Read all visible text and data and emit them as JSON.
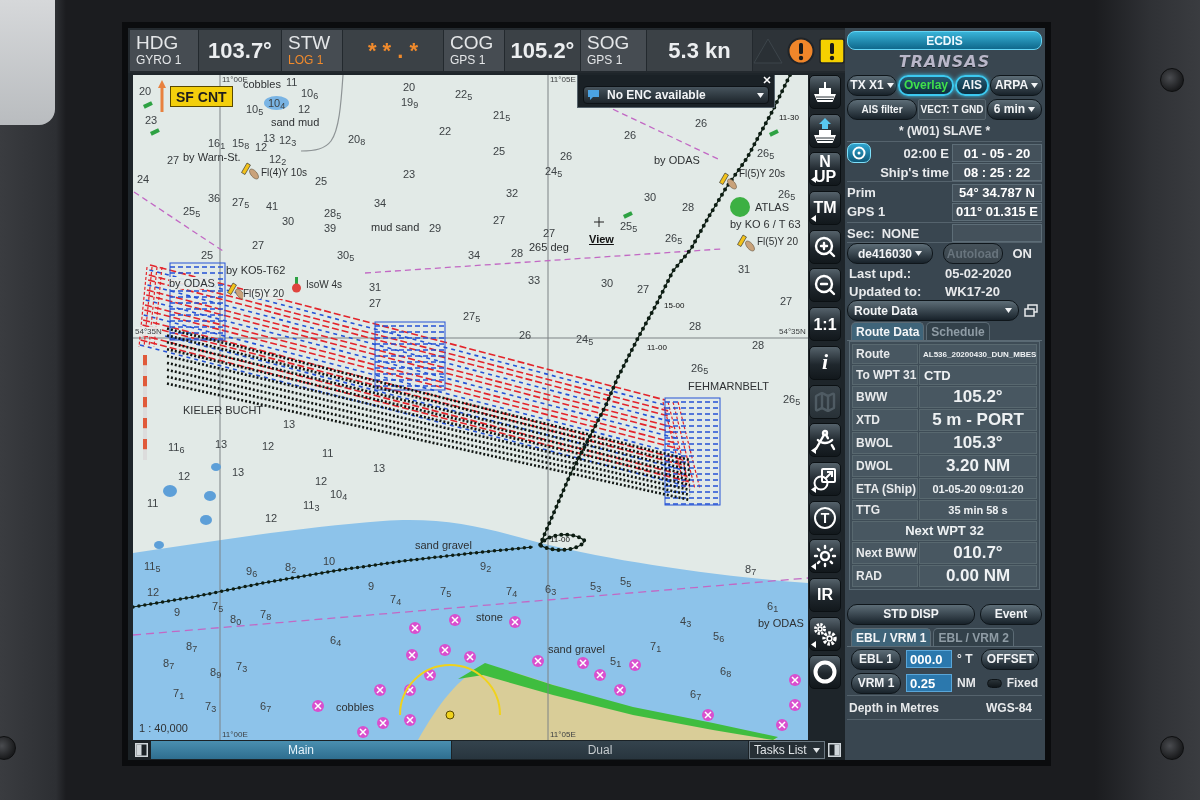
{
  "top_bar": {
    "readouts": [
      {
        "label": "HDG",
        "source": "GYRO 1",
        "value": "103.7°",
        "invalid": false
      },
      {
        "label": "STW",
        "source": "LOG 1",
        "value": "* * . *",
        "invalid": true
      },
      {
        "label": "COG",
        "source": "GPS 1",
        "value": "105.2°",
        "invalid": false
      },
      {
        "label": "SOG",
        "source": "GPS 1",
        "value": "5.3 kn",
        "invalid": false
      }
    ],
    "alarms": [
      {
        "kind": "idle"
      },
      {
        "kind": "alarm"
      },
      {
        "kind": "warning"
      }
    ]
  },
  "map": {
    "tag": "SF CNT",
    "enc_notice": "No ENC available",
    "labels": [
      {
        "text": "cobbles",
        "kind": "name"
      },
      {
        "text": "sand mud",
        "kind": "name"
      },
      {
        "text": "by Warn-St.",
        "kind": "name"
      },
      {
        "text": "Fl(4)Y 10s",
        "kind": "light"
      },
      {
        "text": "mud sand",
        "kind": "name"
      },
      {
        "text": "265 deg",
        "kind": "name"
      },
      {
        "text": "View",
        "kind": "view"
      },
      {
        "text": "by ODAS",
        "kind": "name"
      },
      {
        "text": "Fl(5)Y 20s",
        "kind": "light"
      },
      {
        "text": "ATLAS",
        "kind": "name"
      },
      {
        "text": "by KO 6 / T 63",
        "kind": "name"
      },
      {
        "text": "Fl(5)Y 20",
        "kind": "light"
      },
      {
        "text": "by KO5-T62",
        "kind": "name"
      },
      {
        "text": "by ODAS",
        "kind": "name"
      },
      {
        "text": "Fl(5)Y 20",
        "kind": "light"
      },
      {
        "text": "IsoW 4s",
        "kind": "light"
      },
      {
        "text": "54°35N",
        "kind": "grid"
      },
      {
        "text": "54°35N",
        "kind": "grid"
      },
      {
        "text": "FEHMARNBELT",
        "kind": "name"
      },
      {
        "text": "KIELER BUCHT",
        "kind": "name"
      },
      {
        "text": "sand gravel",
        "kind": "name"
      },
      {
        "text": "stone",
        "kind": "name"
      },
      {
        "text": "sand gravel",
        "kind": "name"
      },
      {
        "text": "by ODAS",
        "kind": "name"
      },
      {
        "text": "cobbles",
        "kind": "name"
      },
      {
        "text": "11°00E",
        "kind": "grid"
      },
      {
        "text": "11°05E",
        "kind": "grid"
      },
      {
        "text": "11°00E",
        "kind": "grid"
      },
      {
        "text": "11°05E",
        "kind": "grid"
      },
      {
        "text": "11-30",
        "kind": "time"
      },
      {
        "text": "15-00",
        "kind": "time"
      },
      {
        "text": "11-00",
        "kind": "time"
      },
      {
        "text": "11-00",
        "kind": "time"
      },
      {
        "text": "1 : 40,000",
        "kind": "name"
      }
    ],
    "soundings": [
      "20",
      "23",
      "16$_{1}$",
      "27",
      "15$_{8}$",
      "12",
      "12$_{2}$",
      "13",
      "12$_{3}$",
      "10$_{6}$",
      "10$_{5}$",
      "10$_{4}$",
      "12",
      "11",
      "20",
      "19$_{9}$",
      "22$_{5}$",
      "21$_{5}$",
      "22",
      "20$_{8}$",
      "25",
      "23",
      "25",
      "36",
      "27$_{5}$",
      "41",
      "34",
      "32",
      "26",
      "24$_{5}$",
      "25$_{5}$",
      "24",
      "30",
      "28$_{5}$",
      "39",
      "29",
      "27",
      "27",
      "25",
      "30$_{5}$",
      "34",
      "28",
      "27",
      "25$_{5}$",
      "26$_{5}$",
      "30",
      "28",
      "26",
      "26",
      "26$_{5}$",
      "26$_{5}$",
      "31",
      "33",
      "30",
      "27",
      "31",
      "27",
      "27$_{5}$",
      "26",
      "24$_{5}$",
      "28",
      "27",
      "28",
      "26$_{5}$",
      "26$_{5}$",
      "11$_{6}$",
      "13",
      "13",
      "11",
      "12",
      "13",
      "13",
      "12",
      "10$_{4}$",
      "11$_{3}$",
      "12",
      "11",
      "12",
      "11$_{5}$",
      "12",
      "9",
      "8$_{7}$",
      "7$_{5}$",
      "9$_{6}$",
      "8$_{2}$",
      "10",
      "9",
      "7$_{4}$",
      "7$_{8}$",
      "8$_{0}$",
      "8$_{7}$",
      "8$_{9}$",
      "7$_{3}$",
      "6$_{4}$",
      "7$_{5}$",
      "9$_{2}$",
      "7$_{4}$",
      "6$_{3}$",
      "5$_{3}$",
      "5$_{5}$",
      "4$_{3}$",
      "5$_{6}$",
      "8$_{7}$",
      "6$_{1}$",
      "5$_{1}$",
      "7$_{1}$",
      "6$_{7}$",
      "6$_{8}$",
      "7$_{3}$",
      "6$_{7}$",
      "7$_{1}$"
    ]
  },
  "toolbar": [
    {
      "kind": "icon",
      "submenu": false,
      "disabled": false
    },
    {
      "kind": "icon",
      "submenu": false,
      "disabled": false
    },
    {
      "kind": "text",
      "label": "N UP",
      "submenu": true,
      "disabled": false
    },
    {
      "kind": "text",
      "label": "TM",
      "submenu": true,
      "disabled": false
    },
    {
      "kind": "icon",
      "submenu": false,
      "disabled": false
    },
    {
      "kind": "icon",
      "submenu": false,
      "disabled": false
    },
    {
      "kind": "text",
      "label": "1:1",
      "submenu": false,
      "disabled": false
    },
    {
      "kind": "italic",
      "label": "i",
      "submenu": false,
      "disabled": false
    },
    {
      "kind": "icon",
      "submenu": false,
      "disabled": true
    },
    {
      "kind": "icon",
      "submenu": true,
      "disabled": false
    },
    {
      "kind": "icon",
      "submenu": true,
      "disabled": false
    },
    {
      "kind": "circled",
      "label": "T",
      "submenu": false,
      "disabled": false
    },
    {
      "kind": "icon",
      "submenu": true,
      "disabled": false
    },
    {
      "kind": "text",
      "label": "IR",
      "submenu": false,
      "disabled": false
    },
    {
      "kind": "icon",
      "submenu": true,
      "disabled": false
    },
    {
      "kind": "icon",
      "submenu": false,
      "disabled": false
    }
  ],
  "panel": {
    "title": "ECDIS",
    "brand": "TRANSAS",
    "display_buttons": [
      {
        "kind": "dropdown",
        "label": "TX X1",
        "selected": false,
        "lit": false
      },
      {
        "kind": "toggle",
        "label": "Overlay",
        "selected": true,
        "lit": true
      },
      {
        "kind": "toggle",
        "label": "AIS",
        "selected": true,
        "lit": false
      },
      {
        "kind": "dropdown",
        "label": "ARPA",
        "selected": false,
        "lit": false
      }
    ],
    "vector_controls": [
      {
        "kind": "button",
        "label": "AIS filter"
      },
      {
        "kind": "readout",
        "label": "VECT: T GND"
      },
      {
        "kind": "dropdown",
        "label": "6 min"
      }
    ],
    "mode": "* (W01) SLAVE *",
    "time": {
      "zone": "02:00 E",
      "date": "01 - 05 - 20",
      "label": "Ship's time",
      "clock": "08 : 25 : 22"
    },
    "position": {
      "label": "Prim",
      "sensor": "GPS 1",
      "lat": "54° 34.787 N",
      "lon": "011° 01.315 E"
    },
    "secondary": "Sec:  NONE",
    "chart": {
      "cell": "de416030",
      "autoload": "Autoload",
      "autoload_disabled": true,
      "status": "ON"
    },
    "updates": [
      {
        "label": "Last upd.:",
        "value": "05-02-2020"
      },
      {
        "label": "Updated to:",
        "value": "WK17-20"
      }
    ],
    "page": "Route Data",
    "tabs": [
      {
        "label": "Route Data",
        "selected": true
      },
      {
        "label": "Schedule",
        "selected": false
      }
    ],
    "route_rows": [
      {
        "kind": "route",
        "label": "Route",
        "value": "AL536_20200430_DUN_MBES"
      },
      {
        "kind": "text",
        "label": "To WPT 31",
        "value": "CTD"
      },
      {
        "kind": "value",
        "label": "BWW",
        "value": "105.2°"
      },
      {
        "kind": "value",
        "label": "XTD",
        "value": "5 m - PORT"
      },
      {
        "kind": "value",
        "label": "BWOL",
        "value": "105.3°"
      },
      {
        "kind": "value",
        "label": "DWOL",
        "value": "3.20 NM"
      },
      {
        "kind": "time",
        "label": "ETA (Ship)",
        "value": "01-05-20 09:01:20"
      },
      {
        "kind": "time",
        "label": "TTG",
        "value": "35 min 58 s"
      },
      {
        "kind": "header",
        "label": "Next WPT 32"
      },
      {
        "kind": "value",
        "label": "Next BWW",
        "value": "010.7°"
      },
      {
        "kind": "value",
        "label": "RAD",
        "value": "0.00 NM"
      }
    ],
    "actions": [
      "STD DISP",
      "Event"
    ],
    "ebl_tabs": [
      {
        "label": "EBL / VRM 1",
        "selected": true
      },
      {
        "label": "EBL / VRM 2",
        "selected": false
      }
    ],
    "ebl": {
      "button": "EBL 1",
      "value": "000.0",
      "unit": "° T",
      "offset": "OFFSET"
    },
    "vrm": {
      "button": "VRM 1",
      "value": "0.25",
      "unit": "NM",
      "fixed_label": "Fixed",
      "fixed": false
    },
    "footer": {
      "depth": "Depth in Metres",
      "datum": "WGS-84"
    }
  },
  "bottom_bar": {
    "tabs": [
      {
        "label": "Main",
        "selected": true
      },
      {
        "label": "Dual",
        "selected": false
      }
    ],
    "tasks": "Tasks List"
  }
}
